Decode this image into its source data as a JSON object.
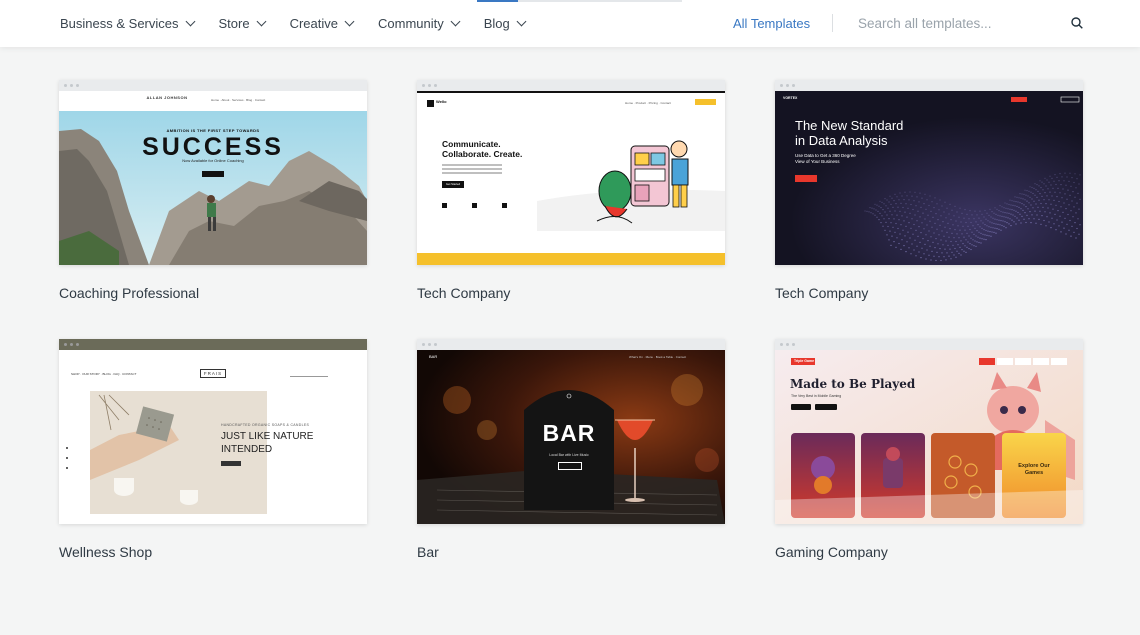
{
  "header": {
    "nav": [
      {
        "label": "Business & Services"
      },
      {
        "label": "Store"
      },
      {
        "label": "Creative"
      },
      {
        "label": "Community"
      },
      {
        "label": "Blog"
      }
    ],
    "all_templates": "All Templates",
    "search_placeholder": "Search all templates...",
    "scroll_progress": 0.2
  },
  "templates": [
    {
      "title": "Coaching Professional",
      "preview": {
        "name": "ALLAN JOHNSON",
        "tagline": "AMBITION IS THE FIRST STEP TOWARDS",
        "headline": "SUCCESS",
        "subline": "Now Available for Online Coaching"
      }
    },
    {
      "title": "Tech Company",
      "preview": {
        "logo": "Wello",
        "headline_1": "Communicate.",
        "headline_2": "Collaborate. Create.",
        "cta": "Get Started"
      }
    },
    {
      "title": "Tech Company",
      "preview": {
        "headline_1": "The New Standard",
        "headline_2": "in Data Analysis",
        "subline_1": "Use Data to Get a 360 Degree",
        "subline_2": "View of Your Business"
      }
    },
    {
      "title": "Wellness Shop",
      "preview": {
        "logo": "FRAIS",
        "eyebrow": "HANDCRAFTED ORGANIC SOAPS & CANDLES",
        "headline_1": "JUST LIKE NATURE",
        "headline_2": "INTENDED"
      }
    },
    {
      "title": "Bar",
      "preview": {
        "headline": "BAR",
        "subline": "Local Bar with Live Music"
      }
    },
    {
      "title": "Gaming Company",
      "preview": {
        "headline": "Made to Be Played",
        "tile_label_1": "Explore Our",
        "tile_label_2": "Games"
      }
    }
  ],
  "colors": {
    "accent": "#3a78c3",
    "background": "#f4f5f5",
    "tech_yellow": "#f5c02b",
    "gaming_red": "#e8372c"
  }
}
